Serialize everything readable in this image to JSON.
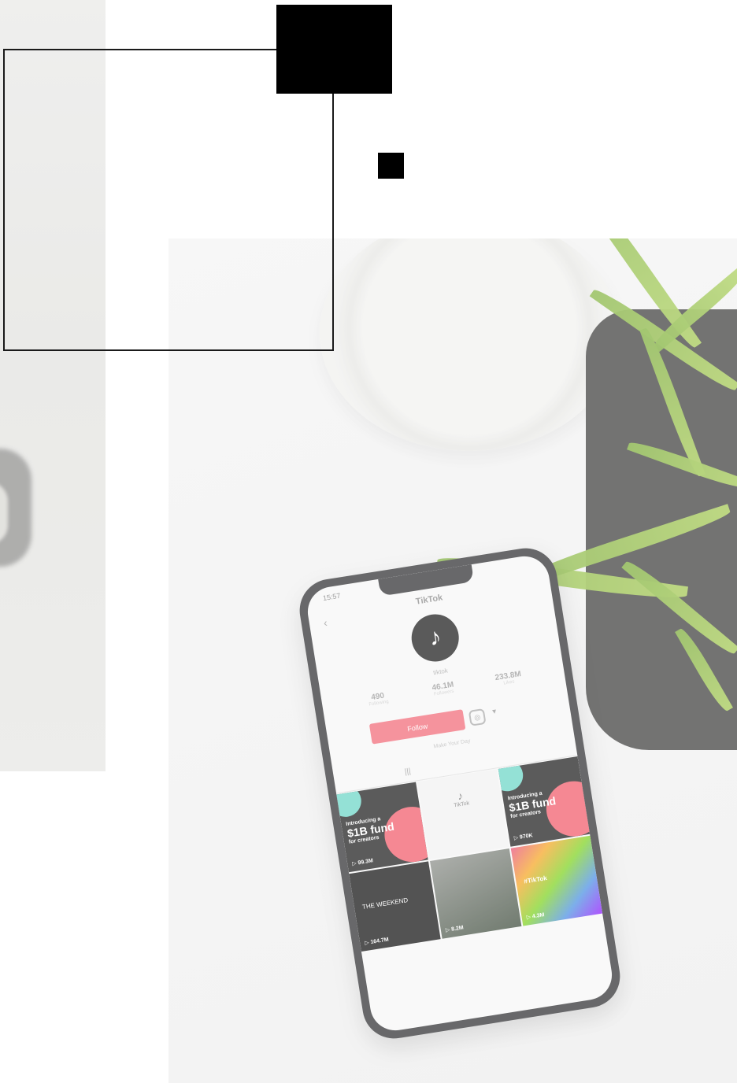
{
  "phone": {
    "status_time": "15:57",
    "app_title": "TikTok",
    "back_glyph": "‹",
    "username": "tiktok",
    "stats": [
      {
        "value": "490",
        "label": "Following"
      },
      {
        "value": "46.1M",
        "label": "Followers"
      },
      {
        "value": "233.8M",
        "label": "Likes"
      }
    ],
    "follow_label": "Follow",
    "instagram_glyph": "◎",
    "more_glyph": "▾",
    "bio": "Make Your Day",
    "grid_glyph": "|||",
    "tiles": [
      {
        "intro": "Introducing a",
        "headline": "$1B fund",
        "sub": "for creators",
        "views": "▷ 99.3M"
      },
      {
        "logo": "♪",
        "note": "TikTok"
      },
      {
        "intro": "Introducing a",
        "headline": "$1B fund",
        "sub": "for creators",
        "views": "▷ 970K"
      },
      {
        "caption": "THE WEEKEND",
        "views": "▷ 164.7M"
      },
      {
        "views": "▷ 8.2M"
      },
      {
        "caption": "#TikTok",
        "views": "▷ 4.3M"
      }
    ]
  },
  "colors": {
    "frame": "#1a1a1a",
    "accent_red": "#f26a78",
    "teal": "#6bd6c7",
    "pot": "#3d3d3c",
    "leaf": "#8fbf45"
  }
}
